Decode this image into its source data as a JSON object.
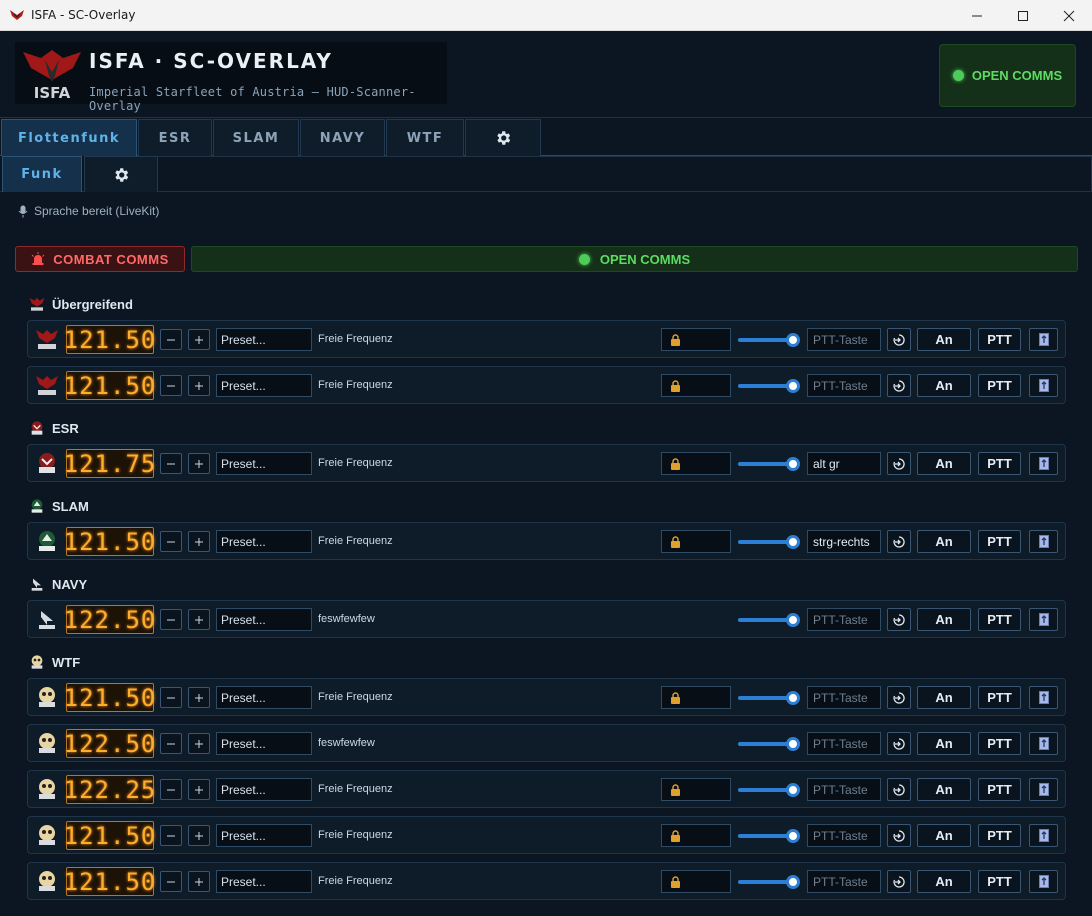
{
  "window": {
    "title": "ISFA - SC-Overlay"
  },
  "header": {
    "logo_text": "ISFA",
    "title": "ISFA · SC-OVERLAY",
    "subtitle": "Imperial Starfleet of Austria — HUD-Scanner-Overlay",
    "open_comms": "OPEN COMMS"
  },
  "tabs": [
    {
      "label": "Flottenfunk",
      "active": true
    },
    {
      "label": "ESR"
    },
    {
      "label": "SLAM"
    },
    {
      "label": "NAVY"
    },
    {
      "label": "WTF"
    },
    {
      "icon": "gear-icon"
    }
  ],
  "subtabs": [
    {
      "label": "Funk",
      "active": true
    },
    {
      "icon": "gear-icon"
    }
  ],
  "status": "Sprache bereit (LiveKit)",
  "actions": {
    "combat": "COMBAT COMMS",
    "open": "OPEN COMMS"
  },
  "labels": {
    "preset": "Preset...",
    "an": "An",
    "ptt": "PTT",
    "ptt_placeholder": "PTT-Taste"
  },
  "colors": {
    "accent": "#5fb3e8",
    "freq": "#ffad2c",
    "open": "#5ddc62",
    "combat": "#ff6a6a",
    "slider": "#2d7fd6"
  },
  "groups": [
    {
      "name": "Übergreifend",
      "icon": "isfa-icon",
      "rows": [
        {
          "freq": "121.50",
          "label": "Freie Frequenz",
          "lock": true,
          "ptt_key": ""
        },
        {
          "freq": "121.50",
          "label": "Freie Frequenz",
          "lock": true,
          "ptt_key": ""
        }
      ]
    },
    {
      "name": "ESR",
      "icon": "esr-icon",
      "rows": [
        {
          "freq": "121.75",
          "label": "Freie Frequenz",
          "lock": true,
          "ptt_key": "alt gr"
        }
      ]
    },
    {
      "name": "SLAM",
      "icon": "slam-icon",
      "rows": [
        {
          "freq": "121.50",
          "label": "Freie Frequenz",
          "lock": true,
          "ptt_key": "strg-rechts"
        }
      ]
    },
    {
      "name": "NAVY",
      "icon": "navy-icon",
      "rows": [
        {
          "freq": "122.50",
          "label": "feswfewfew",
          "lock": false,
          "ptt_key": ""
        }
      ]
    },
    {
      "name": "WTF",
      "icon": "wtf-icon",
      "rows": [
        {
          "freq": "121.50",
          "label": "Freie Frequenz",
          "lock": true,
          "ptt_key": ""
        },
        {
          "freq": "122.50",
          "label": "feswfewfew",
          "lock": false,
          "ptt_key": ""
        },
        {
          "freq": "122.25",
          "label": "Freie Frequenz",
          "lock": true,
          "ptt_key": ""
        },
        {
          "freq": "121.50",
          "label": "Freie Frequenz",
          "lock": true,
          "ptt_key": ""
        },
        {
          "freq": "121.50",
          "label": "Freie Frequenz",
          "lock": true,
          "ptt_key": ""
        }
      ]
    }
  ],
  "volume": 1.0
}
